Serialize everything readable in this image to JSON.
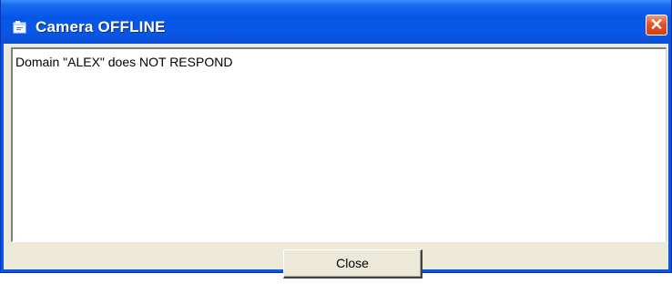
{
  "window": {
    "title": "Camera OFFLINE",
    "title_icon": "window-icon",
    "close_glyph": "✕"
  },
  "message": {
    "text": "Domain \"ALEX\" does NOT RESPOND"
  },
  "buttons": {
    "close_label": "Close"
  },
  "colors": {
    "titlebar": "#0a55e4",
    "close_button": "#e2532a",
    "client_background": "#ece9d8"
  }
}
